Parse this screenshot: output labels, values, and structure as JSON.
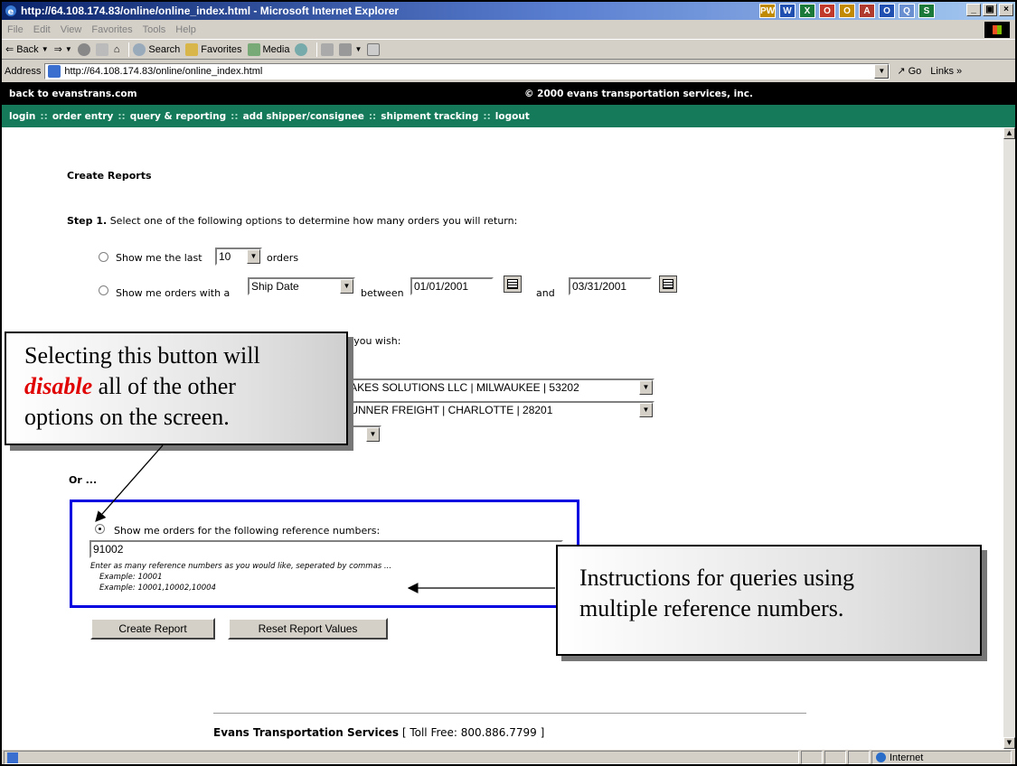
{
  "window": {
    "title": "http://64.108.174.83/online/online_index.html - Microsoft Internet Explorer",
    "taskbar_apps": [
      "PW",
      "W",
      "X",
      "O",
      "O",
      "A",
      "O",
      "Q",
      "S"
    ],
    "controls": {
      "minimize": "_",
      "maximize": "\u0010",
      "close": "×"
    }
  },
  "menu": {
    "items": [
      "File",
      "Edit",
      "View",
      "Favorites",
      "Tools",
      "Help"
    ]
  },
  "toolbar": {
    "back": "Back",
    "search": "Search",
    "favorites": "Favorites",
    "media": "Media"
  },
  "address": {
    "label": "Address",
    "url": "http://64.108.174.83/online/online_index.html",
    "go": "Go",
    "links": "Links"
  },
  "site": {
    "back_link": "back to evanstrans.com",
    "copyright": "© 2000 evans transportation services, inc.",
    "nav": [
      "login",
      "order entry",
      "query & reporting",
      "add shipper/consignee",
      "shipment tracking",
      "logout"
    ],
    "nav_sep": "::"
  },
  "report": {
    "heading": "Create Reports",
    "step1_label": "Step 1.",
    "step1_text": "Select one of the following options to determine how many orders you will return:",
    "opt1_prefix": "Show me the last",
    "opt1_value": "10",
    "opt1_suffix": "orders",
    "opt2_prefix": "Show me orders with a",
    "opt2_field": "Ship Date",
    "opt2_between": "between",
    "opt2_from": "01/01/2001",
    "opt2_and": "and",
    "opt2_to": "03/31/2001",
    "step2_tail": "s you wish:",
    "shipper_partial": "T LAKES SOLUTIONS LLC | MILWAUKEE | 53202",
    "consignee_partial": "DRUNNER FREIGHT | CHARLOTTE | 28201",
    "or": "Or ...",
    "ref_label": "Show me orders for the following reference numbers:",
    "ref_value": "91002",
    "ref_hint": "Enter as many reference numbers as you would like, seperated by commas ...",
    "ref_example1": "Example: 10001",
    "ref_example2": "Example: 10001,10002,10004",
    "create_btn": "Create Report",
    "reset_btn": "Reset Report Values",
    "footer_company": "Evans Transportation Services",
    "footer_phone": "Toll Free: 800.886.7799"
  },
  "callouts": {
    "left_line1": "Selecting this button will",
    "left_emph": "disable",
    "left_line2_rest": " all of the other",
    "left_line3": "options on the screen.",
    "right_line1": "Instructions for queries using",
    "right_line2": "multiple reference numbers."
  },
  "status": {
    "zone": "Internet"
  }
}
